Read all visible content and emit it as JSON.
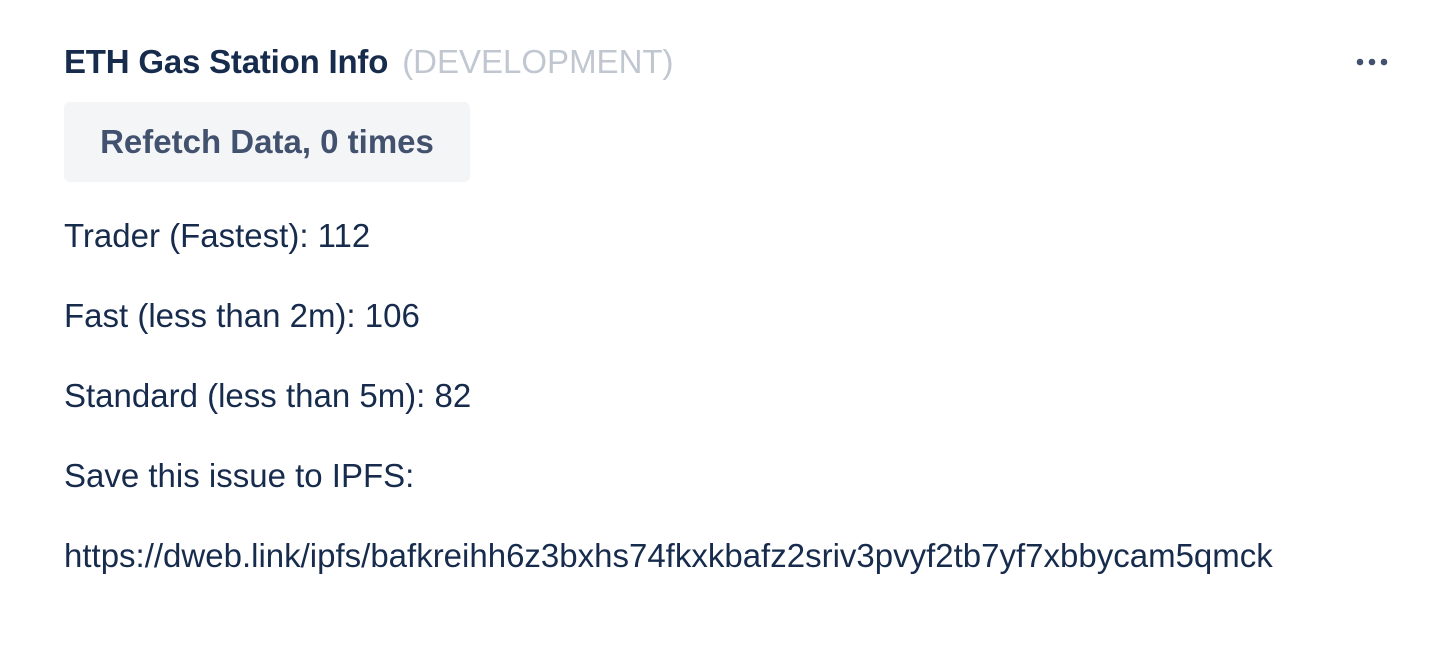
{
  "header": {
    "title": "ETH Gas Station Info",
    "environment": "(DEVELOPMENT)",
    "more_icon": "more-horizontal-icon"
  },
  "refetch": {
    "label": "Refetch Data, 0 times"
  },
  "gas_prices": {
    "trader": "Trader (Fastest): 112",
    "fast": "Fast (less than 2m): 106",
    "standard": "Standard (less than 5m): 82"
  },
  "ipfs": {
    "label": "Save this issue to IPFS:",
    "link": "https://dweb.link/ipfs/bafkreihh6z3bxhs74fkxkbafz2sriv3pvyf2tb7yf7xbbycam5qmck"
  },
  "colors": {
    "text": "#172b4d",
    "muted": "#c1c7d0",
    "button_bg": "#f4f5f7",
    "button_text": "#42526e"
  }
}
